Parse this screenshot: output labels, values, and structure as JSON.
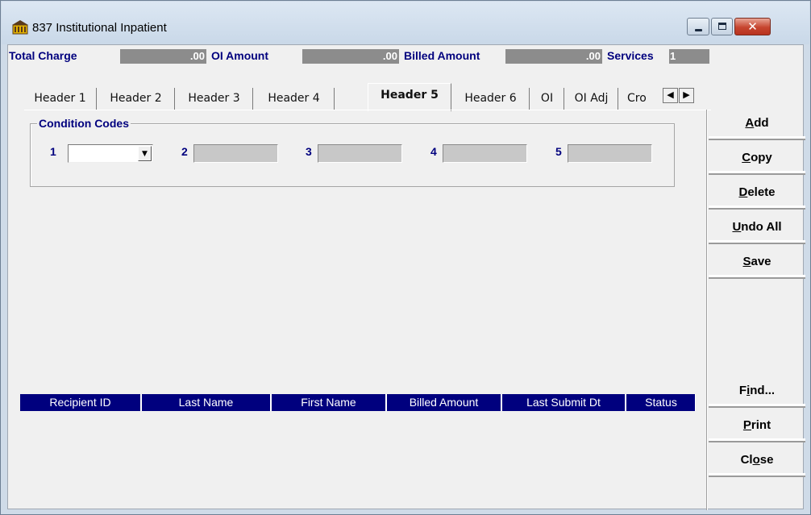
{
  "window": {
    "title": "837 Institutional Inpatient"
  },
  "summary": {
    "total_charge_label": "Total Charge",
    "total_charge_value": ".00",
    "oi_amount_label": "OI Amount",
    "oi_amount_value": ".00",
    "billed_amount_label": "Billed Amount",
    "billed_amount_value": ".00",
    "services_label": "Services",
    "services_value": "1"
  },
  "tabs": [
    {
      "label": "Header 1"
    },
    {
      "label": "Header 2"
    },
    {
      "label": "Header 3"
    },
    {
      "label": "Header 4"
    },
    {
      "label": "Header 5",
      "active": true
    },
    {
      "label": "Header 6"
    },
    {
      "label": "OI"
    },
    {
      "label": "OI Adj"
    },
    {
      "label": "Cro"
    }
  ],
  "condition_codes": {
    "title": "Condition Codes",
    "fields": [
      {
        "label": "1",
        "value": ""
      },
      {
        "label": "2",
        "value": ""
      },
      {
        "label": "3",
        "value": ""
      },
      {
        "label": "4",
        "value": ""
      },
      {
        "label": "5",
        "value": ""
      }
    ]
  },
  "grid": {
    "columns": [
      "Recipient ID",
      "Last Name",
      "First Name",
      "Billed Amount",
      "Last Submit Dt",
      "Status"
    ]
  },
  "buttons": {
    "add": {
      "mnemonic": "A",
      "rest": "dd"
    },
    "copy": {
      "mnemonic": "C",
      "rest": "opy"
    },
    "delete": {
      "mnemonic": "D",
      "rest": "elete"
    },
    "undo_all": {
      "mnemonic": "U",
      "rest": "ndo All"
    },
    "save": {
      "mnemonic": "S",
      "rest": "ave"
    },
    "find": {
      "pre": "F",
      "mnemonic": "i",
      "rest": "nd..."
    },
    "print": {
      "mnemonic": "P",
      "rest": "rint"
    },
    "close": {
      "pre": "Cl",
      "mnemonic": "o",
      "rest": "se"
    }
  },
  "colors": {
    "accent_navy": "#00007e",
    "disabled_field": "#c8c8c8",
    "close_button": "#c6452f"
  },
  "icons": {
    "app": "building-icon",
    "minimize": "minimize-icon",
    "maximize": "maximize-icon",
    "close": "close-icon",
    "scroll_left": "triangle-left-icon",
    "scroll_right": "triangle-right-icon",
    "dropdown": "chevron-down-icon"
  }
}
